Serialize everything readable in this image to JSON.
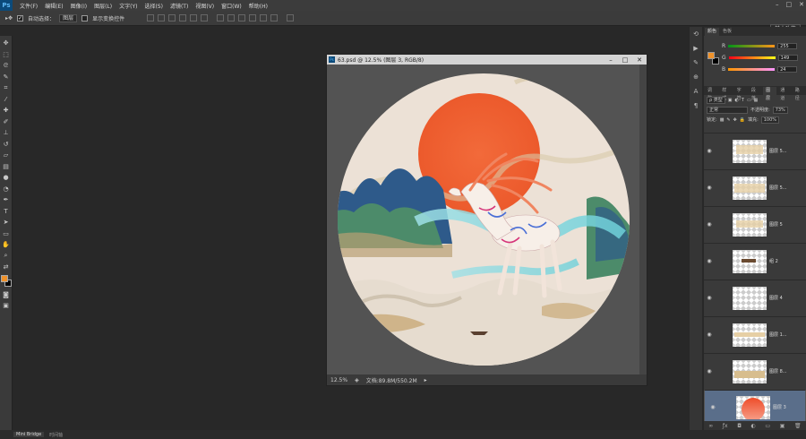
{
  "app": {
    "logo": "Ps"
  },
  "menu": [
    "文件(F)",
    "编辑(E)",
    "图像(I)",
    "图层(L)",
    "文字(Y)",
    "选择(S)",
    "滤镜(T)",
    "视图(V)",
    "窗口(W)",
    "帮助(H)"
  ],
  "window_controls": [
    "–",
    "□",
    "✕"
  ],
  "options": {
    "auto_select_label": "自动选择：",
    "auto_select_value": "图层",
    "transform_label": "显示变换控件",
    "workspace": "基本功能"
  },
  "document": {
    "title": "63.psd @ 12.5% (图层 3, RGB/8)",
    "zoom": "12.5%",
    "doc_info": "文档:89.8M/550.2M"
  },
  "panels": {
    "color_tabs": [
      "颜色",
      "色板"
    ],
    "color": {
      "r_label": "R",
      "r": "255",
      "g_label": "G",
      "g": "149",
      "b_label": "B",
      "b": "24",
      "fg_hex": "#f0922a",
      "bg_hex": "#000000"
    },
    "layer_tabs": [
      "调整",
      "样式",
      "字符",
      "段落",
      "图层",
      "通道",
      "路径"
    ],
    "kind": "ρ 类型",
    "blend_mode": "正常",
    "opacity_label": "不透明度:",
    "opacity": "73%",
    "lock_label": "锁定:",
    "fill_label": "填充:",
    "fill": "100%",
    "layers": [
      {
        "name": "图层 5..."
      },
      {
        "name": "图层 5..."
      },
      {
        "name": "图层 5"
      },
      {
        "name": "组 2"
      },
      {
        "name": "图层 4"
      },
      {
        "name": "图层 1..."
      },
      {
        "name": "图层 8..."
      },
      {
        "name": "图层 3"
      }
    ]
  },
  "bottom": {
    "bridge_tab": "Mini Bridge",
    "timeline_tab": "时间轴"
  }
}
